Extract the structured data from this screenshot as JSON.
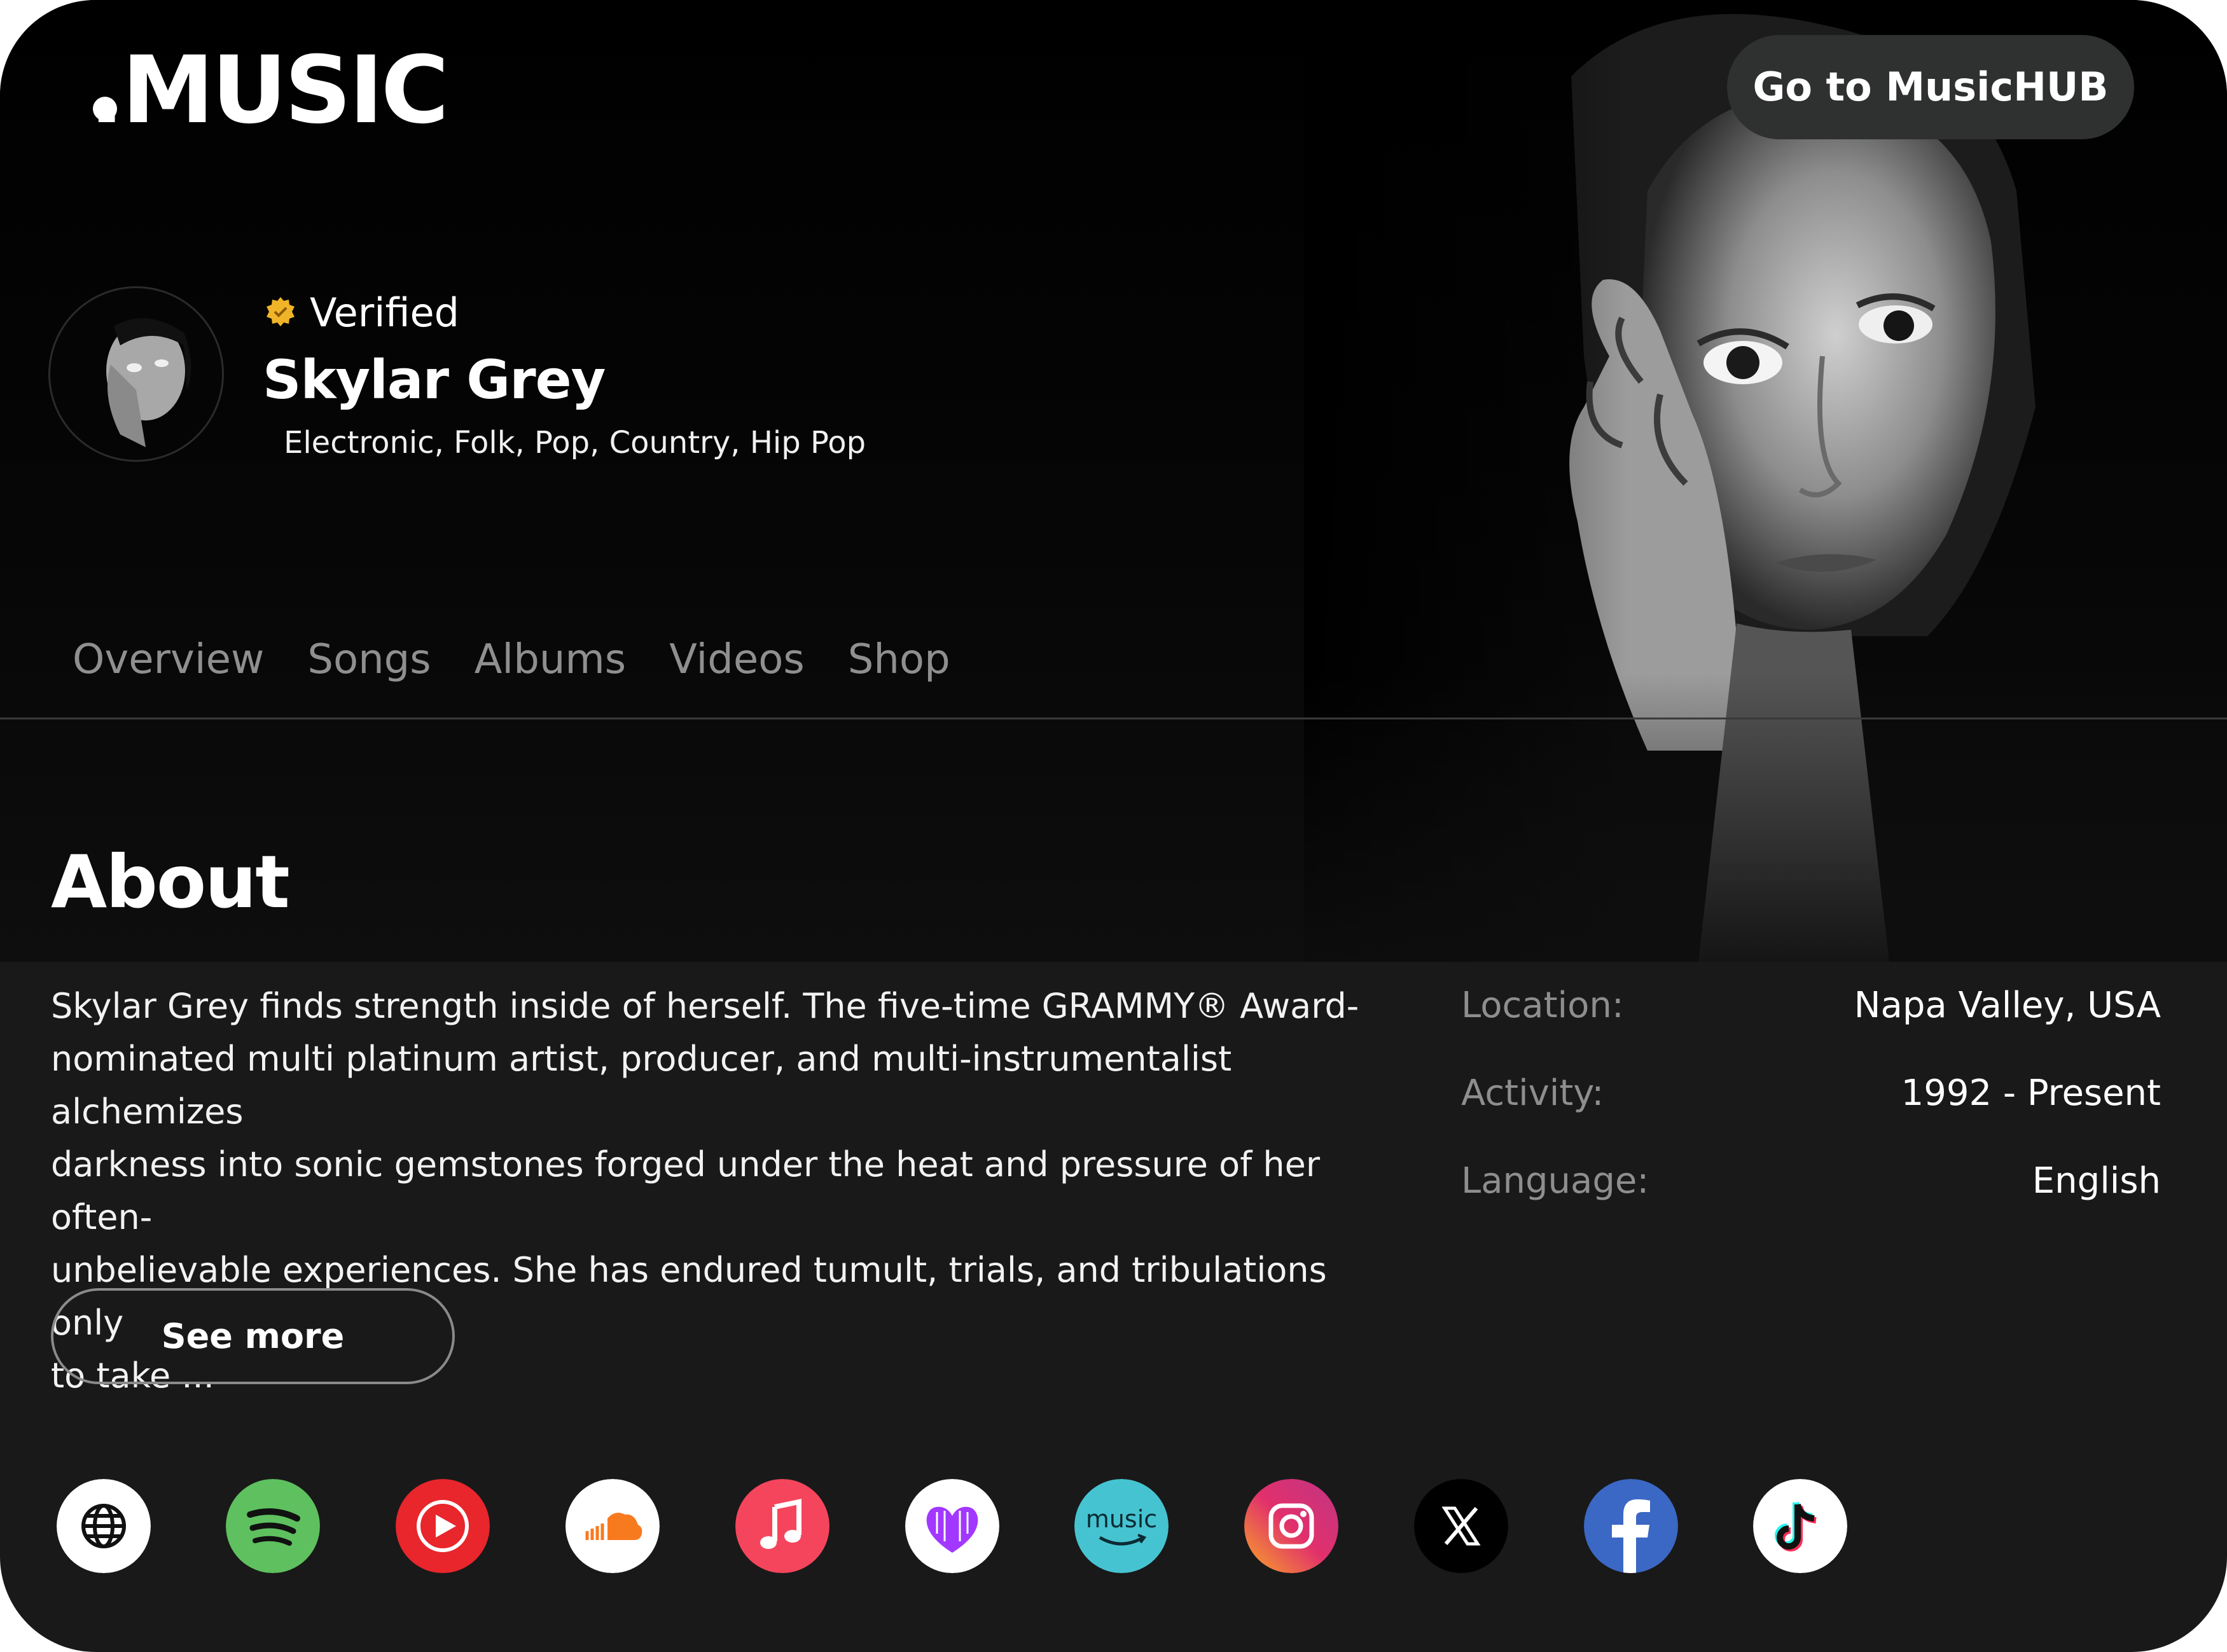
{
  "brand": {
    "logo_text": "MUSIC"
  },
  "header": {
    "hub_button": "Go to MusicHUB"
  },
  "artist": {
    "verified_label": "Verified",
    "name": "Skylar Grey",
    "genres": "Electronic, Folk, Pop, Country, Hip Pop"
  },
  "tabs": [
    {
      "label": "Overview"
    },
    {
      "label": "Songs"
    },
    {
      "label": "Albums"
    },
    {
      "label": "Videos"
    },
    {
      "label": "Shop"
    }
  ],
  "about": {
    "title": "About",
    "bio_lines": [
      "Skylar Grey finds strength inside of herself. The five-time GRAMMY® Award-",
      "nominated multi platinum artist, producer, and multi-instrumentalist alchemizes",
      "darkness into sonic gemstones forged under the heat and pressure of her often-",
      "unbelievable experiences. She has endured tumult, trials, and tribulations only",
      "to take ..."
    ],
    "see_more": "See more"
  },
  "details": [
    {
      "key": "Location:",
      "value": "Napa Valley, USA"
    },
    {
      "key": "Activity:",
      "value": "1992 - Present"
    },
    {
      "key": "Language:",
      "value": "English"
    }
  ],
  "social_links": [
    {
      "icon": "globe-icon",
      "color": "#ffffff"
    },
    {
      "icon": "spotify-icon",
      "color": "#5ec05e"
    },
    {
      "icon": "youtube-music-icon",
      "color": "#e8262c"
    },
    {
      "icon": "soundcloud-icon",
      "color": "#f87a1f"
    },
    {
      "icon": "apple-music-icon",
      "color": "#f5455c"
    },
    {
      "icon": "deezer-icon",
      "color": "#a238ff"
    },
    {
      "icon": "amazon-music-icon",
      "color": "#46c3d1"
    },
    {
      "icon": "instagram-icon",
      "color": "#e1306c"
    },
    {
      "icon": "x-icon",
      "color": "#000000"
    },
    {
      "icon": "facebook-icon",
      "color": "#3b68c4"
    },
    {
      "icon": "tiktok-icon",
      "color": "#ffffff"
    }
  ],
  "social_amazon_text": "music",
  "colors": {
    "background": "#191919",
    "hero": "#000000",
    "accent_verified": "#f0b429",
    "muted_text": "#8e8e8e"
  }
}
